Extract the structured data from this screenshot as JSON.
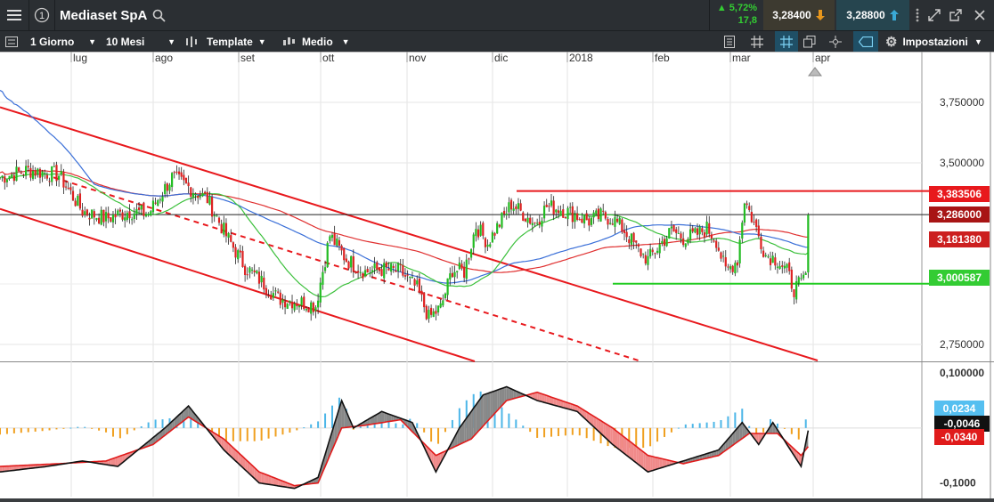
{
  "header": {
    "instrument": "Mediaset SpA",
    "change_pct": "▲ 5,72%",
    "change_abs": "17,8",
    "sell_price": "3,28400",
    "buy_price": "3,28800"
  },
  "toolbar": {
    "interval": "1 Giorno",
    "range": "10 Mesi",
    "template": "Template",
    "size": "Medio",
    "settings": "Impostazioni"
  },
  "axis": {
    "months": [
      "lug",
      "ago",
      "set",
      "ott",
      "nov",
      "dic",
      "2018",
      "feb",
      "mar",
      "apr"
    ],
    "price_ticks": [
      "3,750000",
      "3,500000",
      "2,750000"
    ],
    "macd_ticks": [
      "0,100000",
      "-0,1000"
    ]
  },
  "labels": {
    "resistance": "3,383506",
    "last": "3,286000",
    "ma": "3,181380",
    "support": "3,000587",
    "macd_hist": "0,0234",
    "macd": "-0,0046",
    "signal": "-0,0340"
  },
  "colors": {
    "up": "#22bb22",
    "down": "#dd2222",
    "ma_red": "#e03030",
    "ma_blue": "#3a6fd8",
    "ma_green": "#3cc03c",
    "resistance": "#e8191d",
    "support": "#22cc22",
    "hist_pos": "#4cb6e8",
    "hist_neg": "#f0a020"
  },
  "chart_data": [
    {
      "type": "candlestick",
      "title": "",
      "x_labels": [
        "lug",
        "ago",
        "set",
        "ott",
        "nov",
        "dic",
        "2018",
        "feb",
        "mar",
        "apr"
      ],
      "ylim": [
        2.68,
        3.93
      ],
      "y_ticks": [
        3.75,
        3.5,
        2.75
      ],
      "horizontal_lines": {
        "resistance": 3.383506,
        "last": 3.286,
        "support": 3.000587
      },
      "anchors_close": [
        [
          0,
          3.44
        ],
        [
          12,
          3.47
        ],
        [
          25,
          3.45
        ],
        [
          35,
          3.3
        ],
        [
          45,
          3.27
        ],
        [
          55,
          3.3
        ],
        [
          63,
          3.29
        ],
        [
          73,
          3.44
        ],
        [
          80,
          3.4
        ],
        [
          88,
          3.35
        ],
        [
          96,
          3.2
        ],
        [
          104,
          3.07
        ],
        [
          110,
          3.02
        ],
        [
          118,
          2.94
        ],
        [
          124,
          2.93
        ],
        [
          130,
          2.92
        ],
        [
          134,
          2.91
        ],
        [
          140,
          3.2
        ],
        [
          147,
          3.1
        ],
        [
          155,
          3.05
        ],
        [
          162,
          3.06
        ],
        [
          170,
          3.05
        ],
        [
          177,
          2.98
        ],
        [
          182,
          2.86
        ],
        [
          187,
          2.9
        ],
        [
          192,
          3.06
        ],
        [
          197,
          3.05
        ],
        [
          202,
          3.24
        ],
        [
          207,
          3.17
        ],
        [
          212,
          3.25
        ],
        [
          217,
          3.33
        ],
        [
          222,
          3.29
        ],
        [
          227,
          3.25
        ],
        [
          232,
          3.32
        ],
        [
          238,
          3.31
        ],
        [
          245,
          3.28
        ],
        [
          250,
          3.26
        ],
        [
          255,
          3.28
        ],
        [
          260,
          3.27
        ],
        [
          265,
          3.22
        ],
        [
          270,
          3.15
        ],
        [
          275,
          3.1
        ],
        [
          280,
          3.16
        ],
        [
          285,
          3.22
        ],
        [
          290,
          3.19
        ],
        [
          295,
          3.2
        ],
        [
          300,
          3.23
        ],
        [
          304,
          3.18
        ],
        [
          308,
          3.05
        ],
        [
          313,
          3.1
        ],
        [
          316,
          3.35
        ],
        [
          320,
          3.25
        ],
        [
          325,
          3.12
        ],
        [
          330,
          3.1
        ],
        [
          334,
          3.05
        ],
        [
          337,
          2.98
        ],
        [
          340,
          3.0
        ],
        [
          343,
          3.06
        ]
      ]
    },
    {
      "type": "macd",
      "ylim": [
        -0.125,
        0.118
      ],
      "y_ticks": [
        0.1,
        -0.1
      ],
      "macd_anchors": [
        [
          0,
          -0.08
        ],
        [
          20,
          -0.07
        ],
        [
          35,
          -0.06
        ],
        [
          50,
          -0.07
        ],
        [
          70,
          0.0
        ],
        [
          80,
          0.04
        ],
        [
          95,
          -0.04
        ],
        [
          110,
          -0.1
        ],
        [
          125,
          -0.11
        ],
        [
          135,
          -0.09
        ],
        [
          145,
          0.05
        ],
        [
          150,
          0.0
        ],
        [
          162,
          0.03
        ],
        [
          175,
          0.01
        ],
        [
          185,
          -0.08
        ],
        [
          195,
          0.0
        ],
        [
          205,
          0.06
        ],
        [
          215,
          0.075
        ],
        [
          228,
          0.05
        ],
        [
          245,
          0.03
        ],
        [
          260,
          -0.03
        ],
        [
          275,
          -0.08
        ],
        [
          290,
          -0.06
        ],
        [
          305,
          -0.04
        ],
        [
          315,
          0.01
        ],
        [
          322,
          -0.03
        ],
        [
          328,
          0.01
        ],
        [
          340,
          -0.07
        ],
        [
          343,
          -0.0046
        ]
      ],
      "signal_anchors": [
        [
          0,
          -0.07
        ],
        [
          25,
          -0.065
        ],
        [
          45,
          -0.06
        ],
        [
          65,
          -0.03
        ],
        [
          80,
          0.02
        ],
        [
          95,
          -0.02
        ],
        [
          110,
          -0.08
        ],
        [
          125,
          -0.105
        ],
        [
          135,
          -0.1
        ],
        [
          145,
          0.0
        ],
        [
          155,
          0.005
        ],
        [
          170,
          0.015
        ],
        [
          185,
          -0.05
        ],
        [
          200,
          -0.02
        ],
        [
          215,
          0.05
        ],
        [
          228,
          0.065
        ],
        [
          245,
          0.04
        ],
        [
          260,
          0.0
        ],
        [
          275,
          -0.05
        ],
        [
          290,
          -0.065
        ],
        [
          305,
          -0.05
        ],
        [
          318,
          -0.01
        ],
        [
          330,
          -0.01
        ],
        [
          340,
          -0.05
        ],
        [
          343,
          -0.034
        ]
      ]
    }
  ]
}
